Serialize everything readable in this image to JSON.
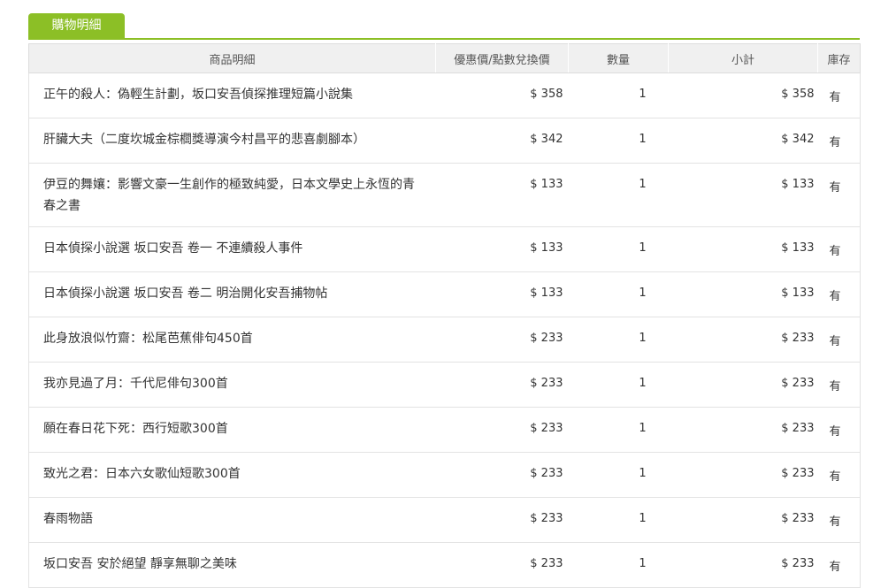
{
  "tab": {
    "label": "購物明細"
  },
  "columns": [
    "商品明細",
    "優惠價/點數兌換價",
    "數量",
    "小計",
    "庫存"
  ],
  "rows": [
    {
      "name": "正午的殺人：偽輕生計劃，坂口安吾偵探推理短篇小說集",
      "price": "$ 358",
      "qty": "1",
      "subtotal": "$ 358",
      "stock": "有"
    },
    {
      "name": "肝臟大夫（二度坎城金棕櫚獎導演今村昌平的悲喜劇腳本）",
      "price": "$ 342",
      "qty": "1",
      "subtotal": "$ 342",
      "stock": "有"
    },
    {
      "name": "伊豆的舞孃：影響文豪一生創作的極致純愛，日本文學史上永恆的青春之書",
      "price": "$ 133",
      "qty": "1",
      "subtotal": "$ 133",
      "stock": "有"
    },
    {
      "name": "日本偵探小說選 坂口安吾 卷一 不連續殺人事件",
      "price": "$ 133",
      "qty": "1",
      "subtotal": "$ 133",
      "stock": "有"
    },
    {
      "name": "日本偵探小說選 坂口安吾 卷二 明治開化安吾捕物帖",
      "price": "$ 133",
      "qty": "1",
      "subtotal": "$ 133",
      "stock": "有"
    },
    {
      "name": "此身放浪似竹齋：松尾芭蕉俳句450首",
      "price": "$ 233",
      "qty": "1",
      "subtotal": "$ 233",
      "stock": "有"
    },
    {
      "name": "我亦見過了月：千代尼俳句300首",
      "price": "$ 233",
      "qty": "1",
      "subtotal": "$ 233",
      "stock": "有"
    },
    {
      "name": "願在春日花下死：西行短歌300首",
      "price": "$ 233",
      "qty": "1",
      "subtotal": "$ 233",
      "stock": "有"
    },
    {
      "name": "致光之君：日本六女歌仙短歌300首",
      "price": "$ 233",
      "qty": "1",
      "subtotal": "$ 233",
      "stock": "有"
    },
    {
      "name": "春雨物語",
      "price": "$ 233",
      "qty": "1",
      "subtotal": "$ 233",
      "stock": "有"
    },
    {
      "name": "坂口安吾 安於絕望 靜享無聊之美味",
      "price": "$ 233",
      "qty": "1",
      "subtotal": "$ 233",
      "stock": "有"
    }
  ]
}
